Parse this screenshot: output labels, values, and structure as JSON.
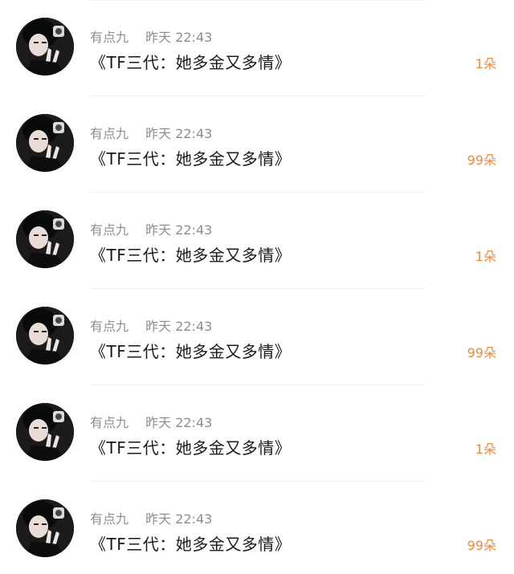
{
  "colors": {
    "accent": "#f08a3c",
    "meta_text": "#8e8e8e",
    "title_text": "#1a1a1a"
  },
  "comments": [
    {
      "author": "有点九",
      "time": "昨天 22:43",
      "title": "《TF三代：她多金又多情》",
      "count": "1朵",
      "avatar_icon": "user-avatar"
    },
    {
      "author": "有点九",
      "time": "昨天 22:43",
      "title": "《TF三代：她多金又多情》",
      "count": "99朵",
      "avatar_icon": "user-avatar"
    },
    {
      "author": "有点九",
      "time": "昨天 22:43",
      "title": "《TF三代：她多金又多情》",
      "count": "1朵",
      "avatar_icon": "user-avatar"
    },
    {
      "author": "有点九",
      "time": "昨天 22:43",
      "title": "《TF三代：她多金又多情》",
      "count": "99朵",
      "avatar_icon": "user-avatar"
    },
    {
      "author": "有点九",
      "time": "昨天 22:43",
      "title": "《TF三代：她多金又多情》",
      "count": "1朵",
      "avatar_icon": "user-avatar"
    },
    {
      "author": "有点九",
      "time": "昨天 22:43",
      "title": "《TF三代：她多金又多情》",
      "count": "99朵",
      "avatar_icon": "user-avatar"
    }
  ]
}
